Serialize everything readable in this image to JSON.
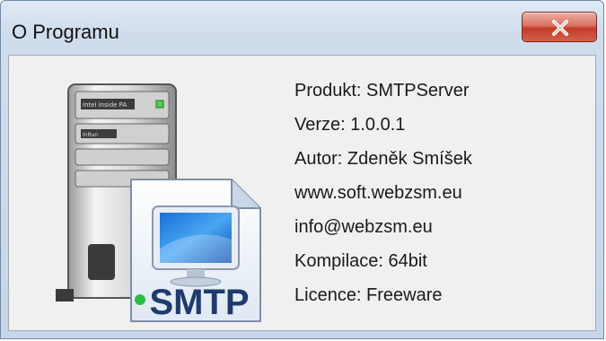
{
  "window": {
    "title": "O Programu"
  },
  "graphic": {
    "badge_text": "SMTP",
    "server_labels": [
      "Intel inside PA",
      "InRun"
    ]
  },
  "info": {
    "product": "Produkt: SMTPServer",
    "version": "Verze: 1.0.0.1",
    "author": "Autor: Zdeněk Smíšek",
    "website": "www.soft.webzsm.eu",
    "email": "info@webzsm.eu",
    "build": "Kompilace: 64bit",
    "license": "Licence: Freeware"
  },
  "icons": {
    "close": "close-icon",
    "app": "smtp-server-icon"
  },
  "colors": {
    "close_button": "#c23c28",
    "window_frame": "#cfdcec",
    "client_bg": "#f0f0f0",
    "badge_text": "#1f3b6e"
  }
}
